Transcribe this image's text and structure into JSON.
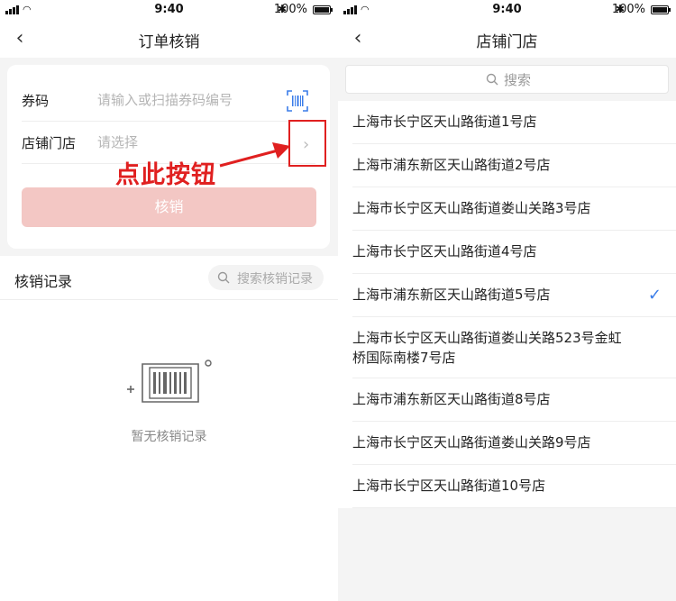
{
  "status": {
    "time": "9:40",
    "battery": "100%"
  },
  "left": {
    "title": "订单核销",
    "coupon_label": "券码",
    "coupon_placeholder": "请输入或扫描券码编号",
    "store_label": "店铺门店",
    "store_placeholder": "请选择",
    "annotation": "点此按钮",
    "submit_label": "核销",
    "records_title": "核销记录",
    "records_search_placeholder": "搜索核销记录",
    "empty_text": "暂无核销记录"
  },
  "right": {
    "title": "店铺门店",
    "search_placeholder": "搜索",
    "stores": [
      {
        "name": "上海市长宁区天山路街道1号店",
        "selected": false
      },
      {
        "name": "上海市浦东新区天山路街道2号店",
        "selected": false
      },
      {
        "name": "上海市长宁区天山路街道娄山关路3号店",
        "selected": false
      },
      {
        "name": "上海市长宁区天山路街道4号店",
        "selected": false
      },
      {
        "name": "上海市浦东新区天山路街道5号店",
        "selected": true
      },
      {
        "name": "上海市长宁区天山路街道娄山关路523号金虹桥国际南楼7号店",
        "selected": false
      },
      {
        "name": "上海市浦东新区天山路街道8号店",
        "selected": false
      },
      {
        "name": "上海市长宁区天山路街道娄山关路9号店",
        "selected": false
      },
      {
        "name": "上海市长宁区天山路街道10号店",
        "selected": false
      }
    ]
  },
  "colors": {
    "accent_red": "#e02020",
    "check_blue": "#3b7de9",
    "button_disabled": "#f3c7c4"
  }
}
